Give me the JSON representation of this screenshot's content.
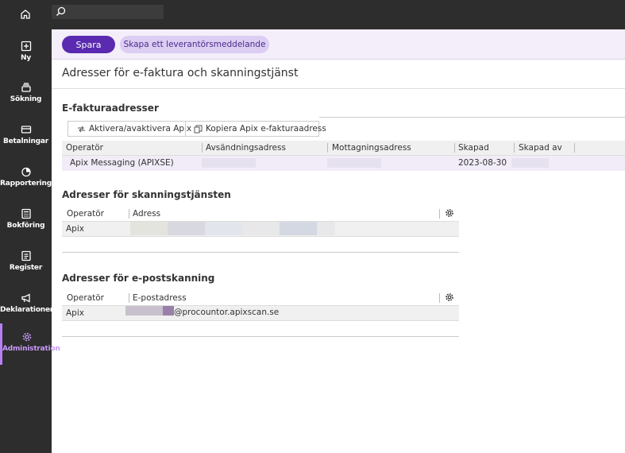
{
  "sidebar": {
    "items": [
      {
        "label": "Ny",
        "icon": "plus-square-icon"
      },
      {
        "label": "Sökning",
        "icon": "stack-search-icon"
      },
      {
        "label": "Betalningar",
        "icon": "card-icon"
      },
      {
        "label": "Rapportering",
        "icon": "pie-chart-icon"
      },
      {
        "label": "Bokföring",
        "icon": "calculator-icon"
      },
      {
        "label": "Register",
        "icon": "list-icon"
      },
      {
        "label": "Deklarationer",
        "icon": "megaphone-icon"
      },
      {
        "label": "Administration",
        "icon": "gear-icon"
      }
    ],
    "active_index": 7
  },
  "toolbar": {
    "save_label": "Spara",
    "supplier_message_label": "Skapa ett leverantörsmeddelande"
  },
  "page": {
    "title": "Adresser för e-faktura och skanningstjänst"
  },
  "efaktura": {
    "title": "E-fakturaadresser",
    "actions": {
      "toggle_label": "Aktivera/avaktivera Apix",
      "copy_label": "Kopiera Apix e-fakturaadress"
    },
    "columns": [
      "Operatör",
      "Avsändningsadress",
      "Mottagningsadress",
      "Skapad",
      "Skapad av"
    ],
    "rows": [
      {
        "operator": "Apix Messaging (APIXSE)",
        "created": "2023-08-30"
      }
    ]
  },
  "scanning": {
    "title": "Adresser för skanningstjänsten",
    "columns": [
      "Operatör",
      "Adress"
    ],
    "rows": [
      {
        "operator": "Apix"
      }
    ]
  },
  "email_scanning": {
    "title": "Adresser för e-postskanning",
    "columns": [
      "Operatör",
      "E-postadress"
    ],
    "rows": [
      {
        "operator": "Apix",
        "email_suffix": "@procountor.apixscan.se"
      }
    ]
  },
  "colors": {
    "sidebar_bg": "#2d2d2d",
    "accent": "#5a2ab0",
    "active_nav": "#c69af8",
    "toolbar_bg": "#f3eef9"
  }
}
